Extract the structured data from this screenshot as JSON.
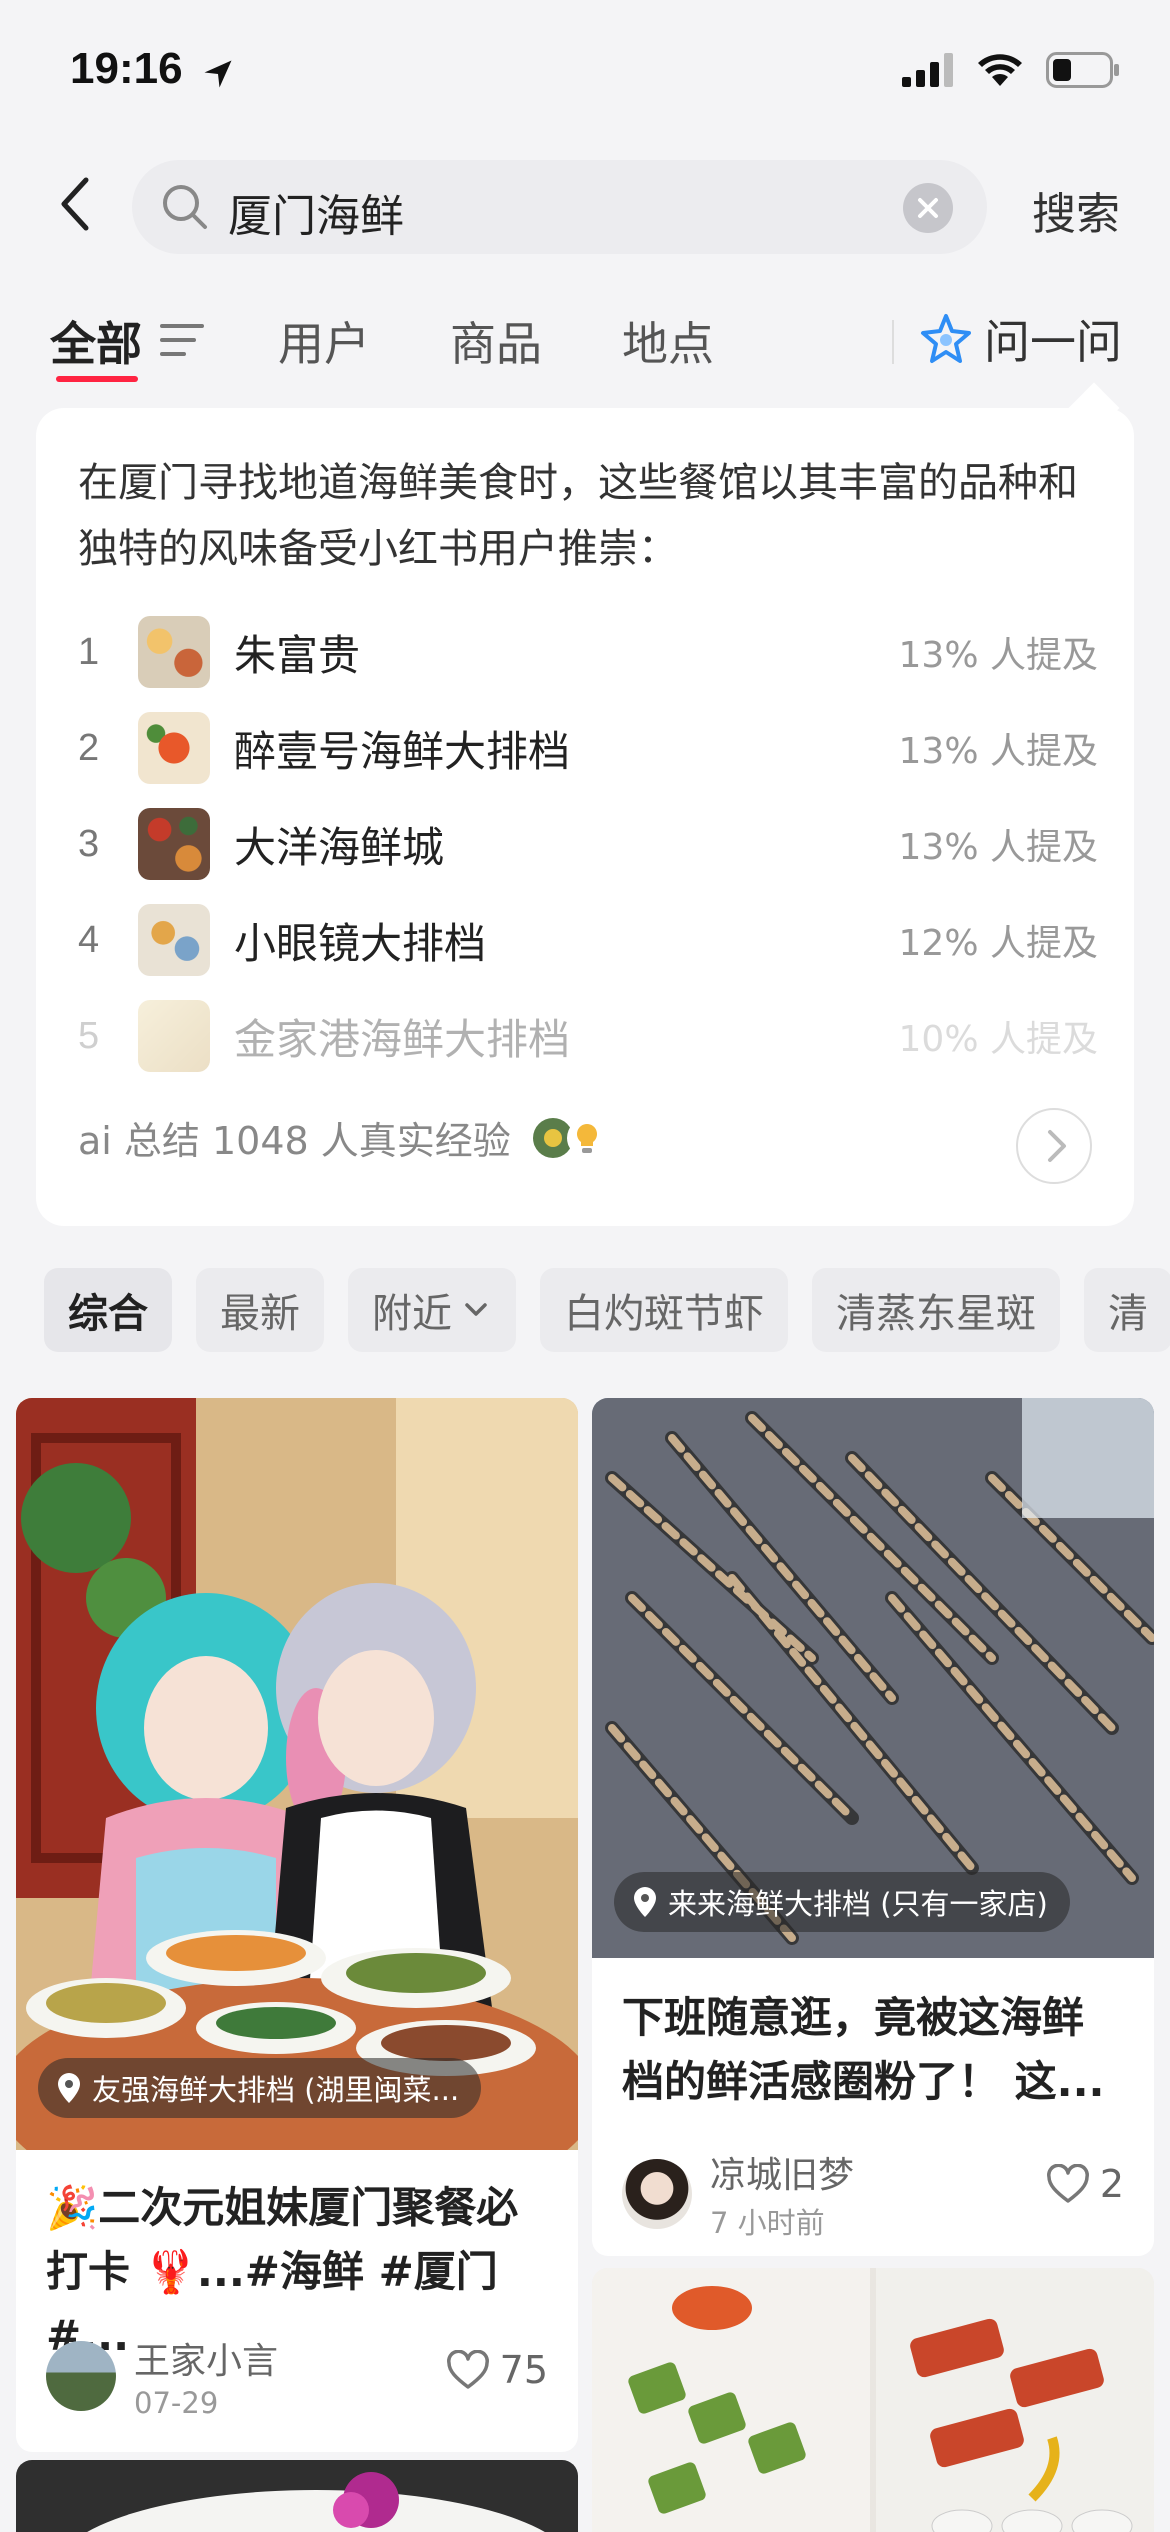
{
  "status": {
    "time": "19:16"
  },
  "search": {
    "query": "厦门海鲜",
    "submit_label": "搜索"
  },
  "tabs": [
    "全部",
    "用户",
    "商品",
    "地点"
  ],
  "ask": {
    "label": "问一问"
  },
  "ai_summary": {
    "intro": "在厦门寻找地道海鲜美食时，这些餐馆以其丰富的品种和独特的风味备受小红书用户推崇：",
    "items": [
      {
        "rank": "1",
        "name": "朱富贵",
        "mention": "13% 人提及"
      },
      {
        "rank": "2",
        "name": "醉壹号海鲜大排档",
        "mention": "13% 人提及"
      },
      {
        "rank": "3",
        "name": "大洋海鲜城",
        "mention": "13% 人提及"
      },
      {
        "rank": "4",
        "name": "小眼镜大排档",
        "mention": "12% 人提及"
      },
      {
        "rank": "5",
        "name": "金家港海鲜大排档",
        "mention": "10% 人提及"
      }
    ],
    "footer": "ai 总结 1048 人真实经验"
  },
  "chips": [
    "综合",
    "最新",
    "附近",
    "白灼斑节虾",
    "清蒸东星斑",
    "清"
  ],
  "feed": [
    {
      "location": "友强海鲜大排档 (湖里闽菜...",
      "title_line1": "🎉二次元姐妹厦门聚餐必",
      "title_line2": "打卡 🦞...#海鲜 #厦门 #...",
      "author": "王家小言",
      "time": "07-29",
      "likes": "75"
    },
    {
      "location": "来来海鲜大排档 (只有一家店)",
      "title_line1": "下班随意逛，竟被这海鲜",
      "title_line2": "档的鲜活感圈粉了！ 这...",
      "author": "凉城旧梦",
      "time": "7 小时前",
      "likes": "2"
    }
  ],
  "colors": {
    "accent": "#ff2442",
    "ask_icon": "#2f8ef5"
  }
}
